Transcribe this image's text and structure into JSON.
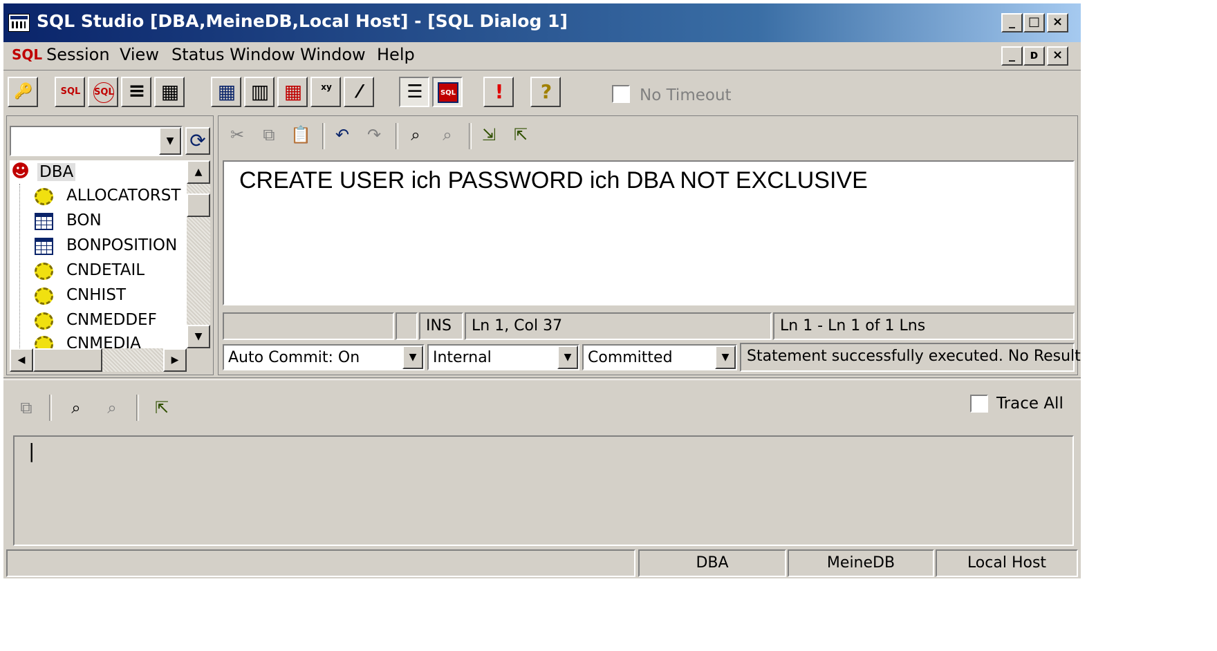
{
  "window": {
    "title": "SQL Studio [DBA,MeineDB,Local Host] - [SQL Dialog 1]",
    "caption_buttons": {
      "minimize": "_",
      "maximize": "□",
      "close": "×"
    },
    "mdi_buttons": {
      "minimize": "_",
      "restore": "ᴅ",
      "close": "×"
    }
  },
  "menu": {
    "sql_prefix": "SQL",
    "items": [
      "Session",
      "View",
      "Status Window",
      "Window",
      "Help"
    ]
  },
  "toolbar": {
    "no_timeout_label": "No Timeout",
    "buttons": [
      {
        "name": "connect-icon",
        "glyph": "🔑"
      },
      {
        "name": "sql-icon",
        "glyph": "SQL"
      },
      {
        "name": "sql-execute-icon",
        "glyph": "SQL"
      },
      {
        "name": "list-icon",
        "glyph": "≡"
      },
      {
        "name": "grid-icon",
        "glyph": "▦"
      },
      {
        "name": "table-icon",
        "glyph": "▦"
      },
      {
        "name": "calculator-icon",
        "glyph": "▥"
      },
      {
        "name": "table-red-icon",
        "glyph": "▦"
      },
      {
        "name": "xy-icon",
        "glyph": "xy"
      },
      {
        "name": "wand-icon",
        "glyph": "⁄"
      },
      {
        "name": "tree-view-icon",
        "glyph": "☰"
      },
      {
        "name": "sql-window-icon",
        "glyph": "SQL"
      },
      {
        "name": "alert-icon",
        "glyph": "!"
      },
      {
        "name": "help-icon",
        "glyph": "?"
      }
    ]
  },
  "tree": {
    "combo_value": "",
    "root": "DBA",
    "items": [
      {
        "label": "ALLOCATORST",
        "icon": "gear"
      },
      {
        "label": "BON",
        "icon": "table"
      },
      {
        "label": "BONPOSITION",
        "icon": "table"
      },
      {
        "label": "CNDETAIL",
        "icon": "gear"
      },
      {
        "label": "CNHIST",
        "icon": "gear"
      },
      {
        "label": "CNMEDDEF",
        "icon": "gear"
      },
      {
        "label": "CNMEDIA",
        "icon": "gear"
      }
    ]
  },
  "editor": {
    "text": "CREATE USER ich PASSWORD ich DBA NOT EXCLUSIVE",
    "mode": "INS",
    "position": "Ln 1, Col 37",
    "line_info": "Ln 1 - Ln 1 of 1 Lns",
    "edit_icons": [
      "✂",
      "⧉",
      "📋",
      "↶",
      "↷",
      "⌕",
      "⌕",
      "⇲",
      "⇱"
    ]
  },
  "options": {
    "auto_commit": "Auto Commit: On",
    "mode": "Internal",
    "isolation": "Committed",
    "status_message": "Statement successfully executed. No Result"
  },
  "trace": {
    "trace_all_label": "Trace All",
    "output_text": "|"
  },
  "statusbar": {
    "user": "DBA",
    "database": "MeineDB",
    "host": "Local Host"
  }
}
